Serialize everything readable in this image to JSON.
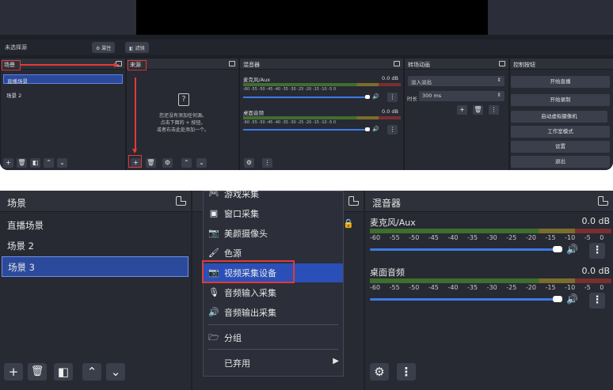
{
  "top": {
    "toolbar": {
      "no_source": "未选择源",
      "properties": "属性",
      "filters": "滤镜"
    },
    "scenes": {
      "title": "场景",
      "items": [
        "直播场景",
        "场景 2"
      ]
    },
    "sources": {
      "title": "来源",
      "hint_line1": "您还没有添加任何源。",
      "hint_line2": "点击下面的 + 按钮，",
      "hint_line3": "或者右击此处添加一个。",
      "q_icon": "?"
    },
    "mixer": {
      "title": "混音器",
      "channels": [
        {
          "name": "麦克风/Aux",
          "db": "0.0 dB"
        },
        {
          "name": "桌面音频",
          "db": "0.0 dB"
        }
      ],
      "ticks": "-60 -55 -50 -45 -40 -35 -30 -25 -20 -15 -10 -5 0"
    },
    "transitions": {
      "title": "转场动画",
      "selected": "淡入淡出",
      "duration_label": "时长",
      "duration_value": "300 ms"
    },
    "controls": {
      "title": "控制按钮",
      "buttons": [
        "开始直播",
        "开始录制",
        "启动虚拟摄像机",
        "工作室模式",
        "设置",
        "退出"
      ]
    }
  },
  "bottom": {
    "scenes": {
      "title": "场景",
      "items": [
        "直播场景",
        "场景 2",
        "场景 3"
      ],
      "selected_index": 2
    },
    "menu": {
      "items": [
        {
          "label": "游戏采集",
          "icon": "gamepad-icon"
        },
        {
          "label": "窗口采集",
          "icon": "window-icon"
        },
        {
          "label": "美颜摄像头",
          "icon": "camera-icon"
        },
        {
          "label": "色源",
          "icon": "brush-icon"
        },
        {
          "label": "视频采集设备",
          "icon": "camera-icon"
        },
        {
          "label": "音频输入采集",
          "icon": "microphone-icon"
        },
        {
          "label": "音频输出采集",
          "icon": "speaker-icon"
        },
        {
          "label": "分组",
          "icon": "folder-icon"
        },
        {
          "label": "已弃用",
          "icon": "chevron-right-icon"
        }
      ],
      "highlighted_index": 4
    },
    "mixer": {
      "title": "混音器",
      "channels": [
        {
          "name": "麦克风/Aux",
          "db": "0.0 dB"
        },
        {
          "name": "桌面音频",
          "db": "0.0 dB"
        }
      ],
      "ticks": "-60 -55 -50 -45 -40 -35 -30 -25 -20 -15 -10 -5 0"
    }
  },
  "colors": {
    "accent": "#2b4a9b",
    "highlight": "#e03a3a",
    "slider": "#3d7be6"
  }
}
